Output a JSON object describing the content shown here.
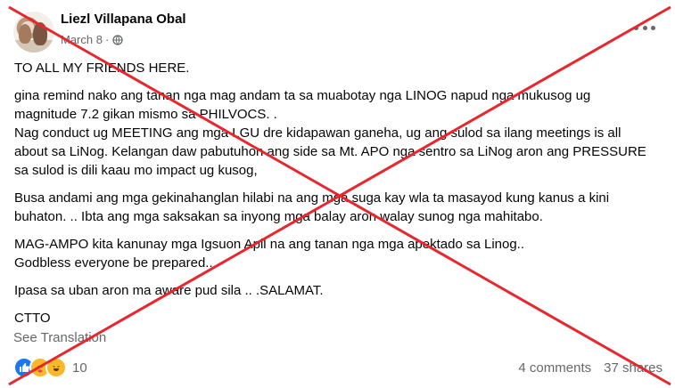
{
  "post": {
    "author": "Liezl Villapana Obal",
    "date": "March 8",
    "date_separator": "·",
    "privacy_icon": "globe-icon",
    "more_icon": "more-dots-icon",
    "paragraphs": [
      [
        "TO ALL MY FRIENDS HERE."
      ],
      [
        "gina remind nako ang tanan nga mag andam ta sa muabotay nga LINOG napud nga mukusog ug",
        "magnitude 7.2 gikan mismo sa PHILVOCS. .",
        "Nag conduct ug MEETING ang mga LGU dre kidapawan ganeha, ug ang sulod sa ilang meetings is all",
        "about sa LiNog. Kelangan daw pabutuhon ang side sa Mt. APO nga sentro sa LiNog aron ang PRESSURE",
        "sa sulod is dili kaau mo impact ug kusog,"
      ],
      [
        "Busa andami ang mga gekinahanglan hilabi na ang mga suga kay wla ta masayod kung kanus a kini",
        "buhaton. .. Ibta ang mga saksakan sa inyong mga balay aron walay sunog nga mahitabo."
      ],
      [
        "MAG-AMPO kita kanunay mga Igsuon Apil na ang tanan nga mga apektado sa Linog..",
        "Godbless everyone be prepared.."
      ],
      [
        "Ipasa sa uban aron ma aware pud sila .. .SALAMAT."
      ],
      [
        "CTTO"
      ]
    ],
    "see_translation": "See Translation",
    "reaction_count": "10",
    "reaction_icons": [
      "like-icon",
      "care-icon",
      "haha-icon"
    ],
    "comments": "4 comments",
    "shares": "37 shares"
  },
  "overlay": {
    "type": "red-x",
    "color": "#e8262e"
  },
  "colors": {
    "text": "#050505",
    "secondary": "#65676b",
    "like": "#1877f2"
  }
}
